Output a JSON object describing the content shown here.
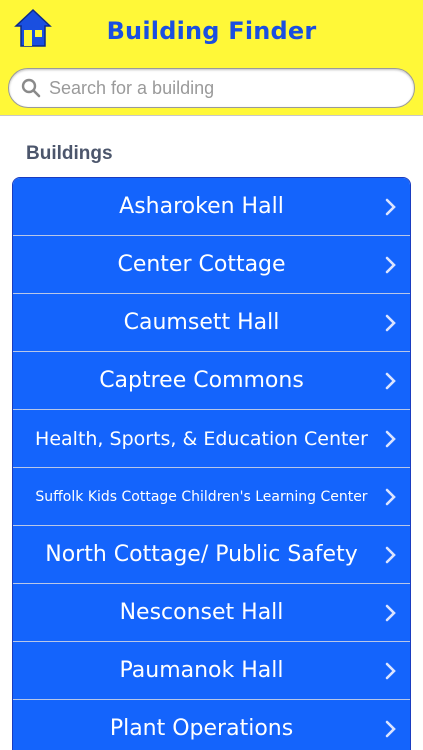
{
  "navbar": {
    "title": "Building Finder",
    "home_icon": "home-icon"
  },
  "search": {
    "placeholder": "Search for a building",
    "value": ""
  },
  "section": {
    "header": "Buildings"
  },
  "buildings": [
    {
      "label": "Asharoken Hall"
    },
    {
      "label": "Center Cottage"
    },
    {
      "label": "Caumsett Hall"
    },
    {
      "label": "Captree Commons"
    },
    {
      "label": "Health, Sports, & Education Center"
    },
    {
      "label": "Suffolk Kids Cottage Children's Learning Center"
    },
    {
      "label": "North Cottage/ Public Safety"
    },
    {
      "label": "Nesconset Hall"
    },
    {
      "label": "Paumanok Hall"
    },
    {
      "label": "Plant Operations"
    }
  ],
  "colors": {
    "navbar_bg": "#fff838",
    "title_blue": "#1a4fe0",
    "row_bg": "#1464fc",
    "section_header": "#4c566c"
  }
}
